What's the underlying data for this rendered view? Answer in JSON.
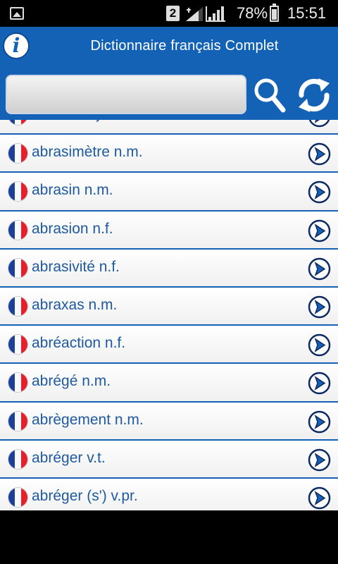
{
  "statusbar": {
    "sim_slot": "2",
    "battery_percent": "78%",
    "battery_level": 0.78,
    "time": "15:51"
  },
  "header": {
    "info_icon": "info-icon",
    "title": "Dictionnaire français Complet",
    "search_value": "",
    "search_icon": "search-icon",
    "refresh_icon": "refresh-icon"
  },
  "list": {
    "flag_icon": "french-flag-icon",
    "arrow_icon": "chevron-right-circle-icon",
    "items": [
      "abrasif adj.",
      "abrasimètre n.m.",
      "abrasin n.m.",
      "abrasion n.f.",
      "abrasivité n.f.",
      "abraxas n.m.",
      "abréaction n.f.",
      "abrégé n.m.",
      "abrègement n.m.",
      "abréger v.t.",
      "abréger (s') v.pr."
    ]
  },
  "colors": {
    "header_blue": "#1462b6",
    "term_blue": "#1f5aa0",
    "flag_blue": "#1d3f9c",
    "flag_red": "#e3202b"
  }
}
